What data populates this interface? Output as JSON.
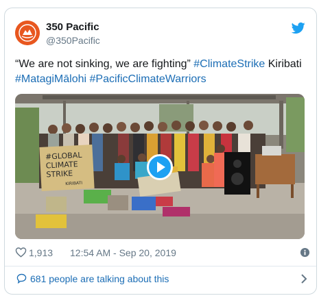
{
  "account": {
    "name": "350 Pacific",
    "handle": "@350Pacific",
    "avatar_icon": "350-pacific-logo-icon",
    "avatar_color": "#e8571f"
  },
  "tweet": {
    "text_before": "“We are not sinking, we are fighting” ",
    "hashtag_1": "#ClimateStrike",
    "text_middle": " Kiribati",
    "hashtag_2": "#MatagiMālohi",
    "hashtag_3": "#PacificClimateWarriors"
  },
  "media": {
    "type": "video",
    "play_icon": "play-icon",
    "signs": [
      "#GLOBAL",
      "CLIMATE",
      "STRIKE",
      "KIRIBATI"
    ]
  },
  "meta": {
    "like_count": "1,913",
    "timestamp": "12:54 AM - Sep 20, 2019",
    "like_icon": "heart-icon",
    "info_icon": "info-icon"
  },
  "footer": {
    "talking_text": "681 people are talking about this",
    "bubble_icon": "comment-bubble-icon",
    "chevron_icon": "chevron-right-icon"
  },
  "colors": {
    "link": "#1b6db5",
    "twitter_blue": "#1da1f2",
    "muted": "#657786",
    "border": "#cfd9de"
  }
}
